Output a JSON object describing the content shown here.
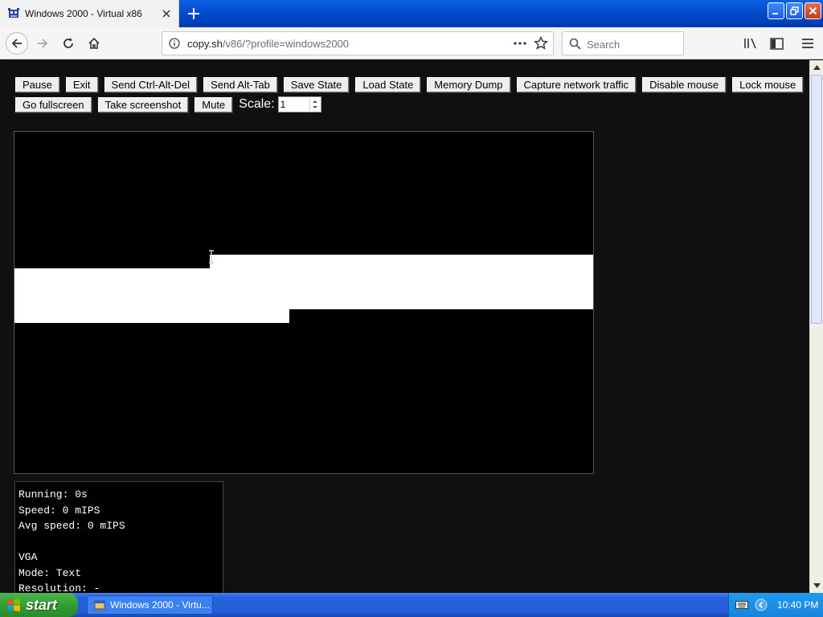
{
  "browser": {
    "tab_title": "Windows 2000 - Virtual x86",
    "url_host": "copy.sh",
    "url_path": "/v86/?profile=windows2000",
    "search_placeholder": "Search"
  },
  "toolbar": {
    "row1": [
      "Pause",
      "Exit",
      "Send Ctrl-Alt-Del",
      "Send Alt-Tab",
      "Save State",
      "Load State",
      "Memory Dump",
      "Capture network traffic",
      "Disable mouse",
      "Lock mouse"
    ],
    "row2": [
      "Go fullscreen",
      "Take screenshot",
      "Mute"
    ],
    "scale_label": "Scale:",
    "scale_value": "1"
  },
  "stats": {
    "running": "Running: 0s",
    "speed": "Speed: 0 mIPS",
    "avg_speed": "Avg speed: 0 mIPS",
    "vga": "VGA",
    "mode": "Mode: Text",
    "resolution": "Resolution: -"
  },
  "taskbar": {
    "start_label": "start",
    "task_item": "Windows 2000 - Virtu...",
    "clock": "10:40 PM"
  },
  "colors": {
    "page_bg": "#101010",
    "taskbar_blue": "#245cd6",
    "start_green": "#2f9a2f",
    "titlebar_blue": "#0046c8"
  }
}
